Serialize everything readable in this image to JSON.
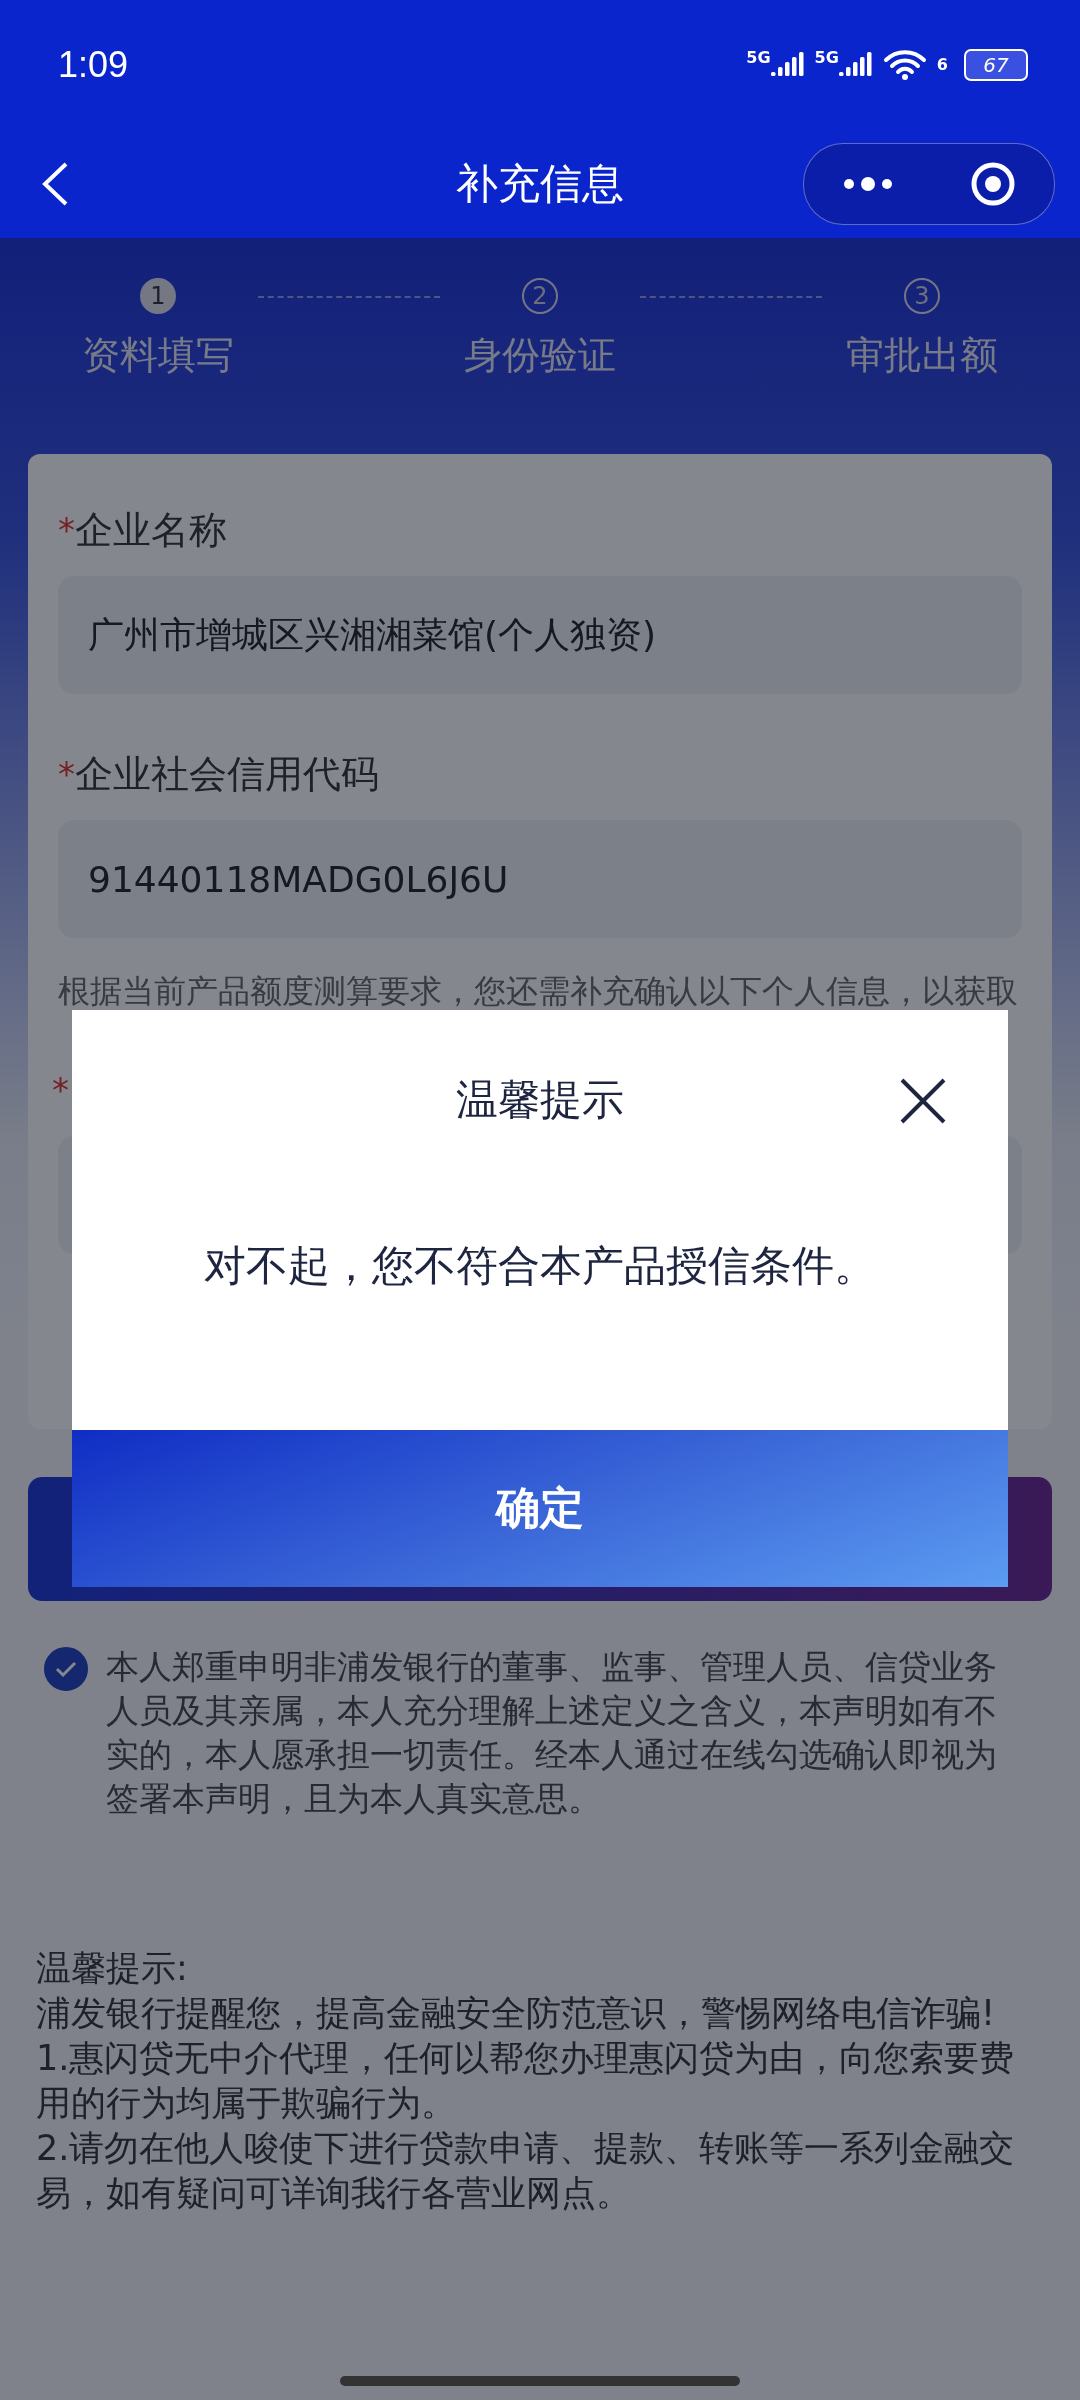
{
  "status_bar": {
    "time": "1:09",
    "networks": [
      "5G",
      "5G"
    ],
    "wifi_label": "6",
    "battery": "67"
  },
  "nav": {
    "title": "补充信息"
  },
  "steps": [
    {
      "number": "1",
      "label": "资料填写",
      "selected": true
    },
    {
      "number": "2",
      "label": "身份验证",
      "selected": false
    },
    {
      "number": "3",
      "label": "审批出额",
      "selected": false
    }
  ],
  "form": {
    "fields": [
      {
        "mark": "*",
        "label": "企业名称",
        "value": "广州市增城区兴湘湘菜馆(个人独资)"
      },
      {
        "mark": "*",
        "label": "企业社会信用代码",
        "value": "91440118MADG0L6J6U"
      }
    ],
    "hint": "根据当前产品额度测算要求，您还需补充确认以下个人信息，以获取",
    "hidden_field": {
      "mark": "*"
    }
  },
  "declaration": {
    "checked": true,
    "text": "本人郑重申明非浦发银行的董事、监事、管理人员、信贷业务人员及其亲属，本人充分理解上述定义之含义，本声明如有不实的，本人愿承担一切责任。经本人通过在线勾选确认即视为签署本声明，且为本人真实意思。"
  },
  "tips": {
    "title": "温馨提示:",
    "lines": [
      "浦发银行提醒您，提高金融安全防范意识，警惕网络电信诈骗!",
      "1.惠闪贷无中介代理，任何以帮您办理惠闪贷为由，向您索要费用的行为均属于欺骗行为。",
      "2.请勿在他人唆使下进行贷款申请、提款、转账等一系列金融交易，如有疑问可详询我行各营业网点。"
    ]
  },
  "dialog": {
    "title": "温馨提示",
    "message": "对不起，您不符合本产品授信条件。",
    "confirm": "确定"
  }
}
